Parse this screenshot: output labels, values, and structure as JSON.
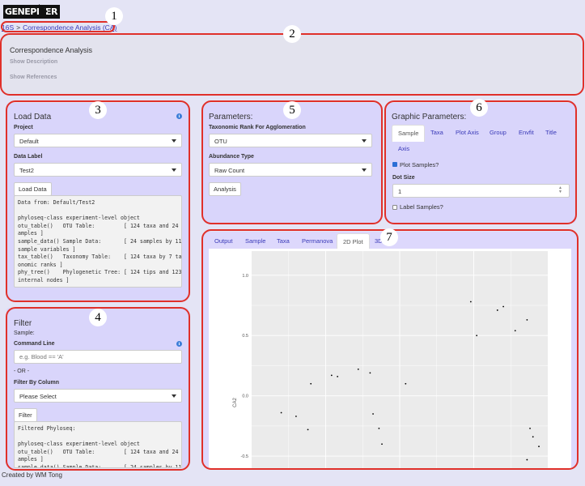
{
  "app": {
    "logo_text": "GENEPIPER"
  },
  "breadcrumb": {
    "root": "16S",
    "separator": ">",
    "current": "Correspondence Analysis (CA)"
  },
  "header": {
    "title": "Correspondence Analysis",
    "show_description": "Show Description",
    "show_references": "Show References"
  },
  "load_data": {
    "title": "Load Data",
    "project_label": "Project",
    "project_value": "Default",
    "data_label_label": "Data Label",
    "data_label_value": "Test2",
    "button": "Load Data",
    "output": "Data from: Default/Test2\n\nphyloseq-class experiment-level object\notu_table()   OTU Table:         [ 124 taxa and 24 s\namples ]\nsample_data() Sample Data:       [ 24 samples by 11\nsample variables ]\ntax_table()   Taxonomy Table:    [ 124 taxa by 7 tax\nonomic ranks ]\nphy_tree()    Phylogenetic Tree: [ 124 tips and 123\ninternal nodes ]"
  },
  "filter": {
    "title": "Filter",
    "sample_label": "Sample:",
    "command_label": "Command Line",
    "command_placeholder": "e.g. Blood == 'A'",
    "or_text": "- OR -",
    "by_column_label": "Filter By Column",
    "by_column_value": "Please Select",
    "button": "Filter",
    "output": "Filtered Phyloseq:\n\nphyloseq-class experiment-level object\notu_table()   OTU Table:         [ 124 taxa and 24 s\namples ]\nsample_data() Sample Data:       [ 24 samples by 11"
  },
  "parameters": {
    "title": "Parameters:",
    "rank_label": "Taxonomic Rank For Agglomeration",
    "rank_value": "OTU",
    "abundance_label": "Abundance Type",
    "abundance_value": "Raw Count",
    "button": "Analysis"
  },
  "graphic": {
    "title": "Graphic Parameters:",
    "tabs": [
      "Sample",
      "Taxa",
      "Plot Axis",
      "Group",
      "Envfit",
      "Title",
      "Axis"
    ],
    "plot_samples_label": "Plot Samples?",
    "plot_samples_checked": true,
    "dot_size_label": "Dot Size",
    "dot_size_value": "1",
    "label_samples_label": "Label Samples?",
    "label_samples_checked": false
  },
  "output_tabs": [
    "Output",
    "Sample",
    "Taxa",
    "Permanova",
    "2D Plot",
    "3D"
  ],
  "output_active_tab": "2D Plot",
  "callouts": [
    "1",
    "2",
    "3",
    "4",
    "5",
    "6",
    "7"
  ],
  "footer": "Created by WM Tong",
  "chart_data": {
    "type": "scatter",
    "ylabel": "CA2",
    "yticks": [
      "1.0",
      "0.5",
      "0.0",
      "-0.5"
    ],
    "ylim": [
      -0.6,
      1.2
    ],
    "xlim": [
      0,
      1
    ],
    "grid": true,
    "background": "#ebebeb",
    "points": [
      {
        "x": 0.1,
        "y": -0.14
      },
      {
        "x": 0.15,
        "y": -0.17
      },
      {
        "x": 0.19,
        "y": -0.28
      },
      {
        "x": 0.2,
        "y": 0.1
      },
      {
        "x": 0.27,
        "y": 0.17
      },
      {
        "x": 0.29,
        "y": 0.16
      },
      {
        "x": 0.36,
        "y": 0.22
      },
      {
        "x": 0.4,
        "y": 0.19
      },
      {
        "x": 0.41,
        "y": -0.15
      },
      {
        "x": 0.43,
        "y": -0.27
      },
      {
        "x": 0.44,
        "y": -0.4
      },
      {
        "x": 0.52,
        "y": 0.1
      },
      {
        "x": 0.74,
        "y": 0.78
      },
      {
        "x": 0.76,
        "y": 0.5
      },
      {
        "x": 0.83,
        "y": 0.71
      },
      {
        "x": 0.85,
        "y": 0.74
      },
      {
        "x": 0.89,
        "y": 0.54
      },
      {
        "x": 0.93,
        "y": 0.63
      },
      {
        "x": 0.94,
        "y": -0.27
      },
      {
        "x": 0.95,
        "y": -0.34
      },
      {
        "x": 0.97,
        "y": -0.42
      },
      {
        "x": 0.93,
        "y": -0.53
      }
    ]
  },
  "colors": {
    "accent": "#3a3ab8",
    "panel": "#d9d5fb",
    "callout_border": "#e0302a"
  }
}
